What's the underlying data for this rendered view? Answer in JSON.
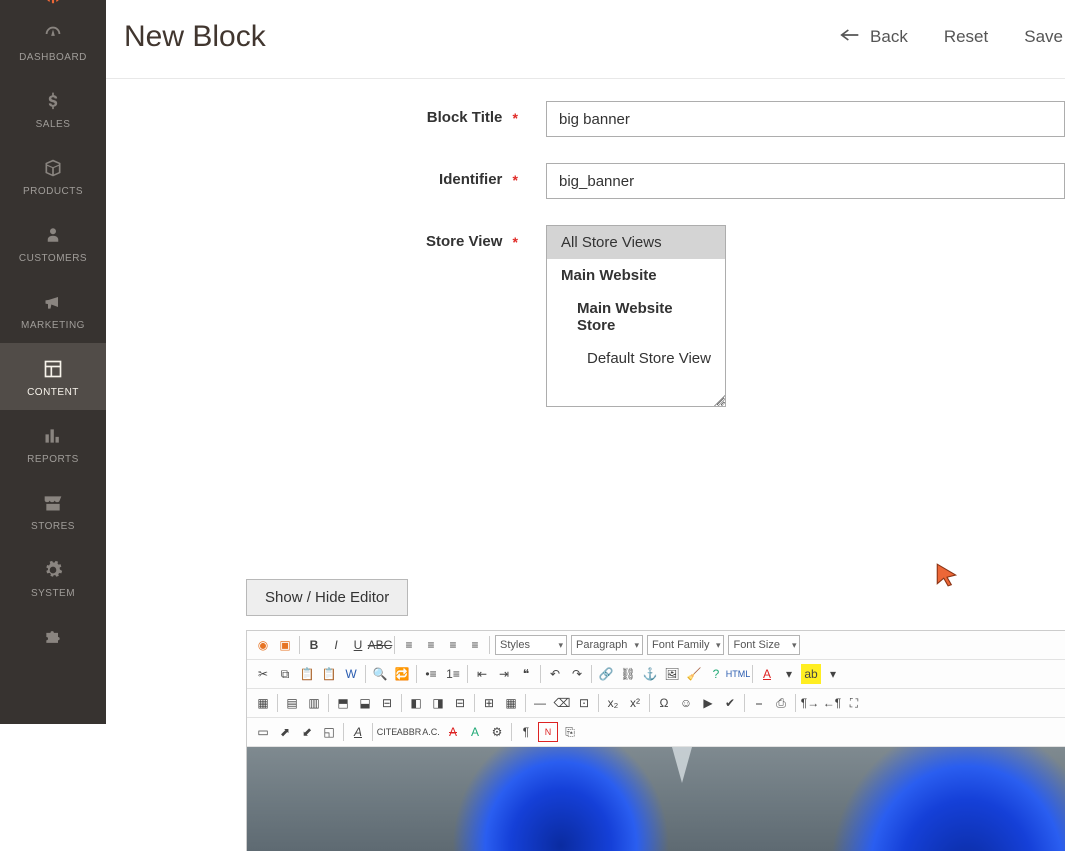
{
  "sidebar": {
    "items": [
      {
        "label": "DASHBOARD",
        "icon": "dashboard-icon"
      },
      {
        "label": "SALES",
        "icon": "dollar-icon"
      },
      {
        "label": "PRODUCTS",
        "icon": "box-icon"
      },
      {
        "label": "CUSTOMERS",
        "icon": "person-icon"
      },
      {
        "label": "MARKETING",
        "icon": "megaphone-icon"
      },
      {
        "label": "CONTENT",
        "icon": "layout-icon"
      },
      {
        "label": "REPORTS",
        "icon": "barchart-icon"
      },
      {
        "label": "STORES",
        "icon": "stores-icon"
      },
      {
        "label": "SYSTEM",
        "icon": "gear-icon"
      }
    ]
  },
  "header": {
    "title": "New Block",
    "back": "Back",
    "reset": "Reset",
    "save": "Save"
  },
  "form": {
    "block_title_label": "Block Title",
    "block_title_value": "big banner",
    "identifier_label": "Identifier",
    "identifier_value": "big_banner",
    "store_view_label": "Store View",
    "store_view_options": {
      "all": "All Store Views",
      "website": "Main Website",
      "store": "Main Website Store",
      "view": "Default Store View"
    },
    "editor_toggle": "Show / Hide Editor",
    "editor_selects": {
      "styles": "Styles",
      "format": "Paragraph",
      "font_family": "Font Family",
      "font_size": "Font Size"
    }
  }
}
